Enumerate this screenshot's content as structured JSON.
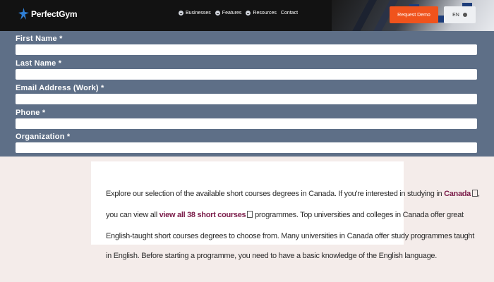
{
  "header": {
    "brand": "PerfectGym",
    "nav": [
      {
        "label": "Businesses",
        "icon": "chevron-down-icon"
      },
      {
        "label": "Features",
        "icon": "chevron-down-icon"
      },
      {
        "label": "Resources",
        "icon": "chevron-down-icon"
      },
      {
        "label": "Contact"
      }
    ],
    "request_demo": "Request Demo",
    "language": "EN",
    "accent_color": "#f0531c"
  },
  "form": {
    "background": "#5e6f87",
    "fields": [
      {
        "label": "First Name *",
        "value": ""
      },
      {
        "label": "Last Name *",
        "value": ""
      },
      {
        "label": "Email Address (Work) *",
        "value": ""
      },
      {
        "label": "Phone *",
        "value": ""
      },
      {
        "label": "Organization *",
        "value": ""
      }
    ]
  },
  "content": {
    "line1_text": "Explore our selection of the available short courses degrees in Canada. If you're interested in studying in ",
    "line1_link": "Canada",
    "line2_prefix": "you can view all ",
    "line2_link": "view all 38 short courses",
    "line2_suffix": " programmes. Top universities and colleges in Canada offer great",
    "line3": "English-taught short courses degrees to choose from. Many universities in Canada offer study programmes taught",
    "line4": "in English. Before starting a programme, you need to have a basic knowledge of the English language.",
    "link_color": "#7b1d4a"
  }
}
